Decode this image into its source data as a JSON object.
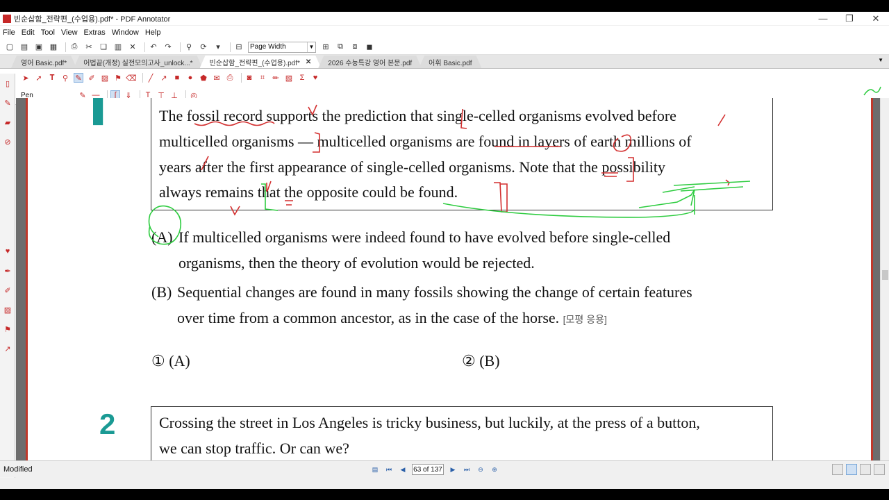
{
  "window": {
    "title": "빈순삽함_전략편_(수업용).pdf* - PDF Annotator",
    "controls": [
      "—",
      "❐",
      "✕"
    ]
  },
  "menu": [
    "File",
    "Edit",
    "Tool",
    "View",
    "Extras",
    "Window",
    "Help"
  ],
  "toolbar": {
    "zoom_value": "Page Width"
  },
  "tabs": [
    {
      "label": "영어 Basic.pdf*"
    },
    {
      "label": "어법끝(개정) 실전모의고사_unlock...*"
    },
    {
      "label": "빈순삽함_전략편_(수업용).pdf*",
      "close": "✕"
    },
    {
      "label": "2026 수능특강 영어 본문.pdf"
    },
    {
      "label": "어휘 Basic.pdf"
    }
  ],
  "annotate": {
    "tool_label": "Pen"
  },
  "document": {
    "q1_passage": [
      "The fossil record supports the prediction that single-celled organisms evolved before",
      "multicelled organisms — multicelled organisms are found in layers of earth millions of",
      "years after the first appearance of single-celled organisms. Note that the possibility",
      "always remains that the opposite could be found."
    ],
    "option_a_label": "(A)",
    "option_a_lines": [
      "If multicelled organisms were indeed found to have evolved before single-celled",
      "organisms, then the theory of evolution would be rejected."
    ],
    "option_b_label": "(B)",
    "option_b_lines": [
      "Sequential changes are found in many fossils showing the change of certain features",
      "over time from a common ancestor, as in the case of the horse."
    ],
    "option_b_source": "[모평 응용]",
    "choices": [
      "① (A)",
      "② (B)"
    ],
    "q2_number": "2",
    "q2_passage": [
      "Crossing the street in Los Angeles is tricky business, but luckily, at the press of a button,",
      "we can stop traffic. Or can we?"
    ]
  },
  "status": {
    "state": "Modified",
    "page_indicator": "63 of 137"
  },
  "colors": {
    "ink_red": "#d32f2f",
    "ink_green": "#2ecc40",
    "teal_number": "#1a9a94",
    "page_border": "#c0392b"
  }
}
